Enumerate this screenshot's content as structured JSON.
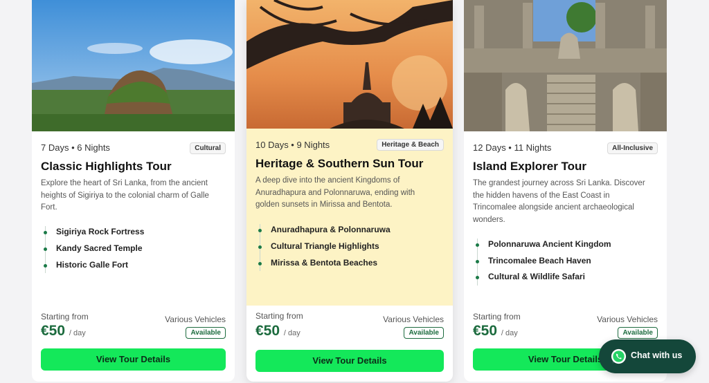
{
  "tours": [
    {
      "duration": "7 Days • 6 Nights",
      "badge": "Cultural",
      "title": "Classic Highlights Tour",
      "description": "Explore the heart of Sri Lanka, from the ancient heights of Sigiriya to the colonial charm of Galle Fort.",
      "highlights": [
        "Sigiriya Rock Fortress",
        "Kandy Sacred Temple",
        "Historic Galle Fort"
      ],
      "starting_label": "Starting from",
      "price": "€50",
      "per": "/ day",
      "vehicles": "Various Vehicles",
      "availability": "Available",
      "cta": "View Tour Details"
    },
    {
      "duration": "10 Days • 9 Nights",
      "badge": "Heritage & Beach",
      "title": "Heritage & Southern Sun Tour",
      "description": "A deep dive into the ancient Kingdoms of Anuradhapura and Polonnaruwa, ending with golden sunsets in Mirissa and Bentota.",
      "highlights": [
        "Anuradhapura & Polonnaruwa",
        "Cultural Triangle Highlights",
        "Mirissa & Bentota Beaches"
      ],
      "starting_label": "Starting from",
      "price": "€50",
      "per": "/ day",
      "vehicles": "Various Vehicles",
      "availability": "Available",
      "cta": "View Tour Details"
    },
    {
      "duration": "12 Days • 11 Nights",
      "badge": "All-Inclusive",
      "title": "Island Explorer Tour",
      "description": "The grandest journey across Sri Lanka. Discover the hidden havens of the East Coast in Trincomalee alongside ancient archaeological wonders.",
      "highlights": [
        "Polonnaruwa Ancient Kingdom",
        "Trincomalee Beach Haven",
        "Cultural & Wildlife Safari"
      ],
      "starting_label": "Starting from",
      "price": "€50",
      "per": "/ day",
      "vehicles": "Various Vehicles",
      "availability": "Available",
      "cta": "View Tour Details"
    }
  ],
  "chat": {
    "label": "Chat with us",
    "icon": "whatsapp-icon"
  },
  "colors": {
    "accent_green": "#14e85a",
    "price_green": "#1c6b3e",
    "chat_bg": "#14473a",
    "highlight_card_bg": "#fdf3c5"
  }
}
